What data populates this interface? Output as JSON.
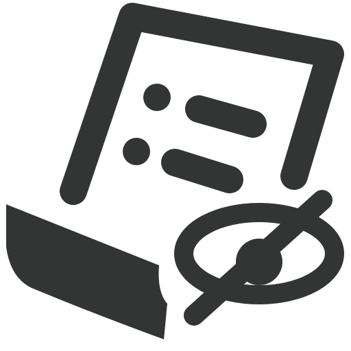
{
  "icon": {
    "name": "hidden-document-list-icon",
    "color": "#333535",
    "background": "#ffffff",
    "parts": [
      "document-sheet-icon",
      "list-bullet-icon",
      "list-line-icon",
      "scroll-curl-icon",
      "eye-slash-icon"
    ]
  }
}
